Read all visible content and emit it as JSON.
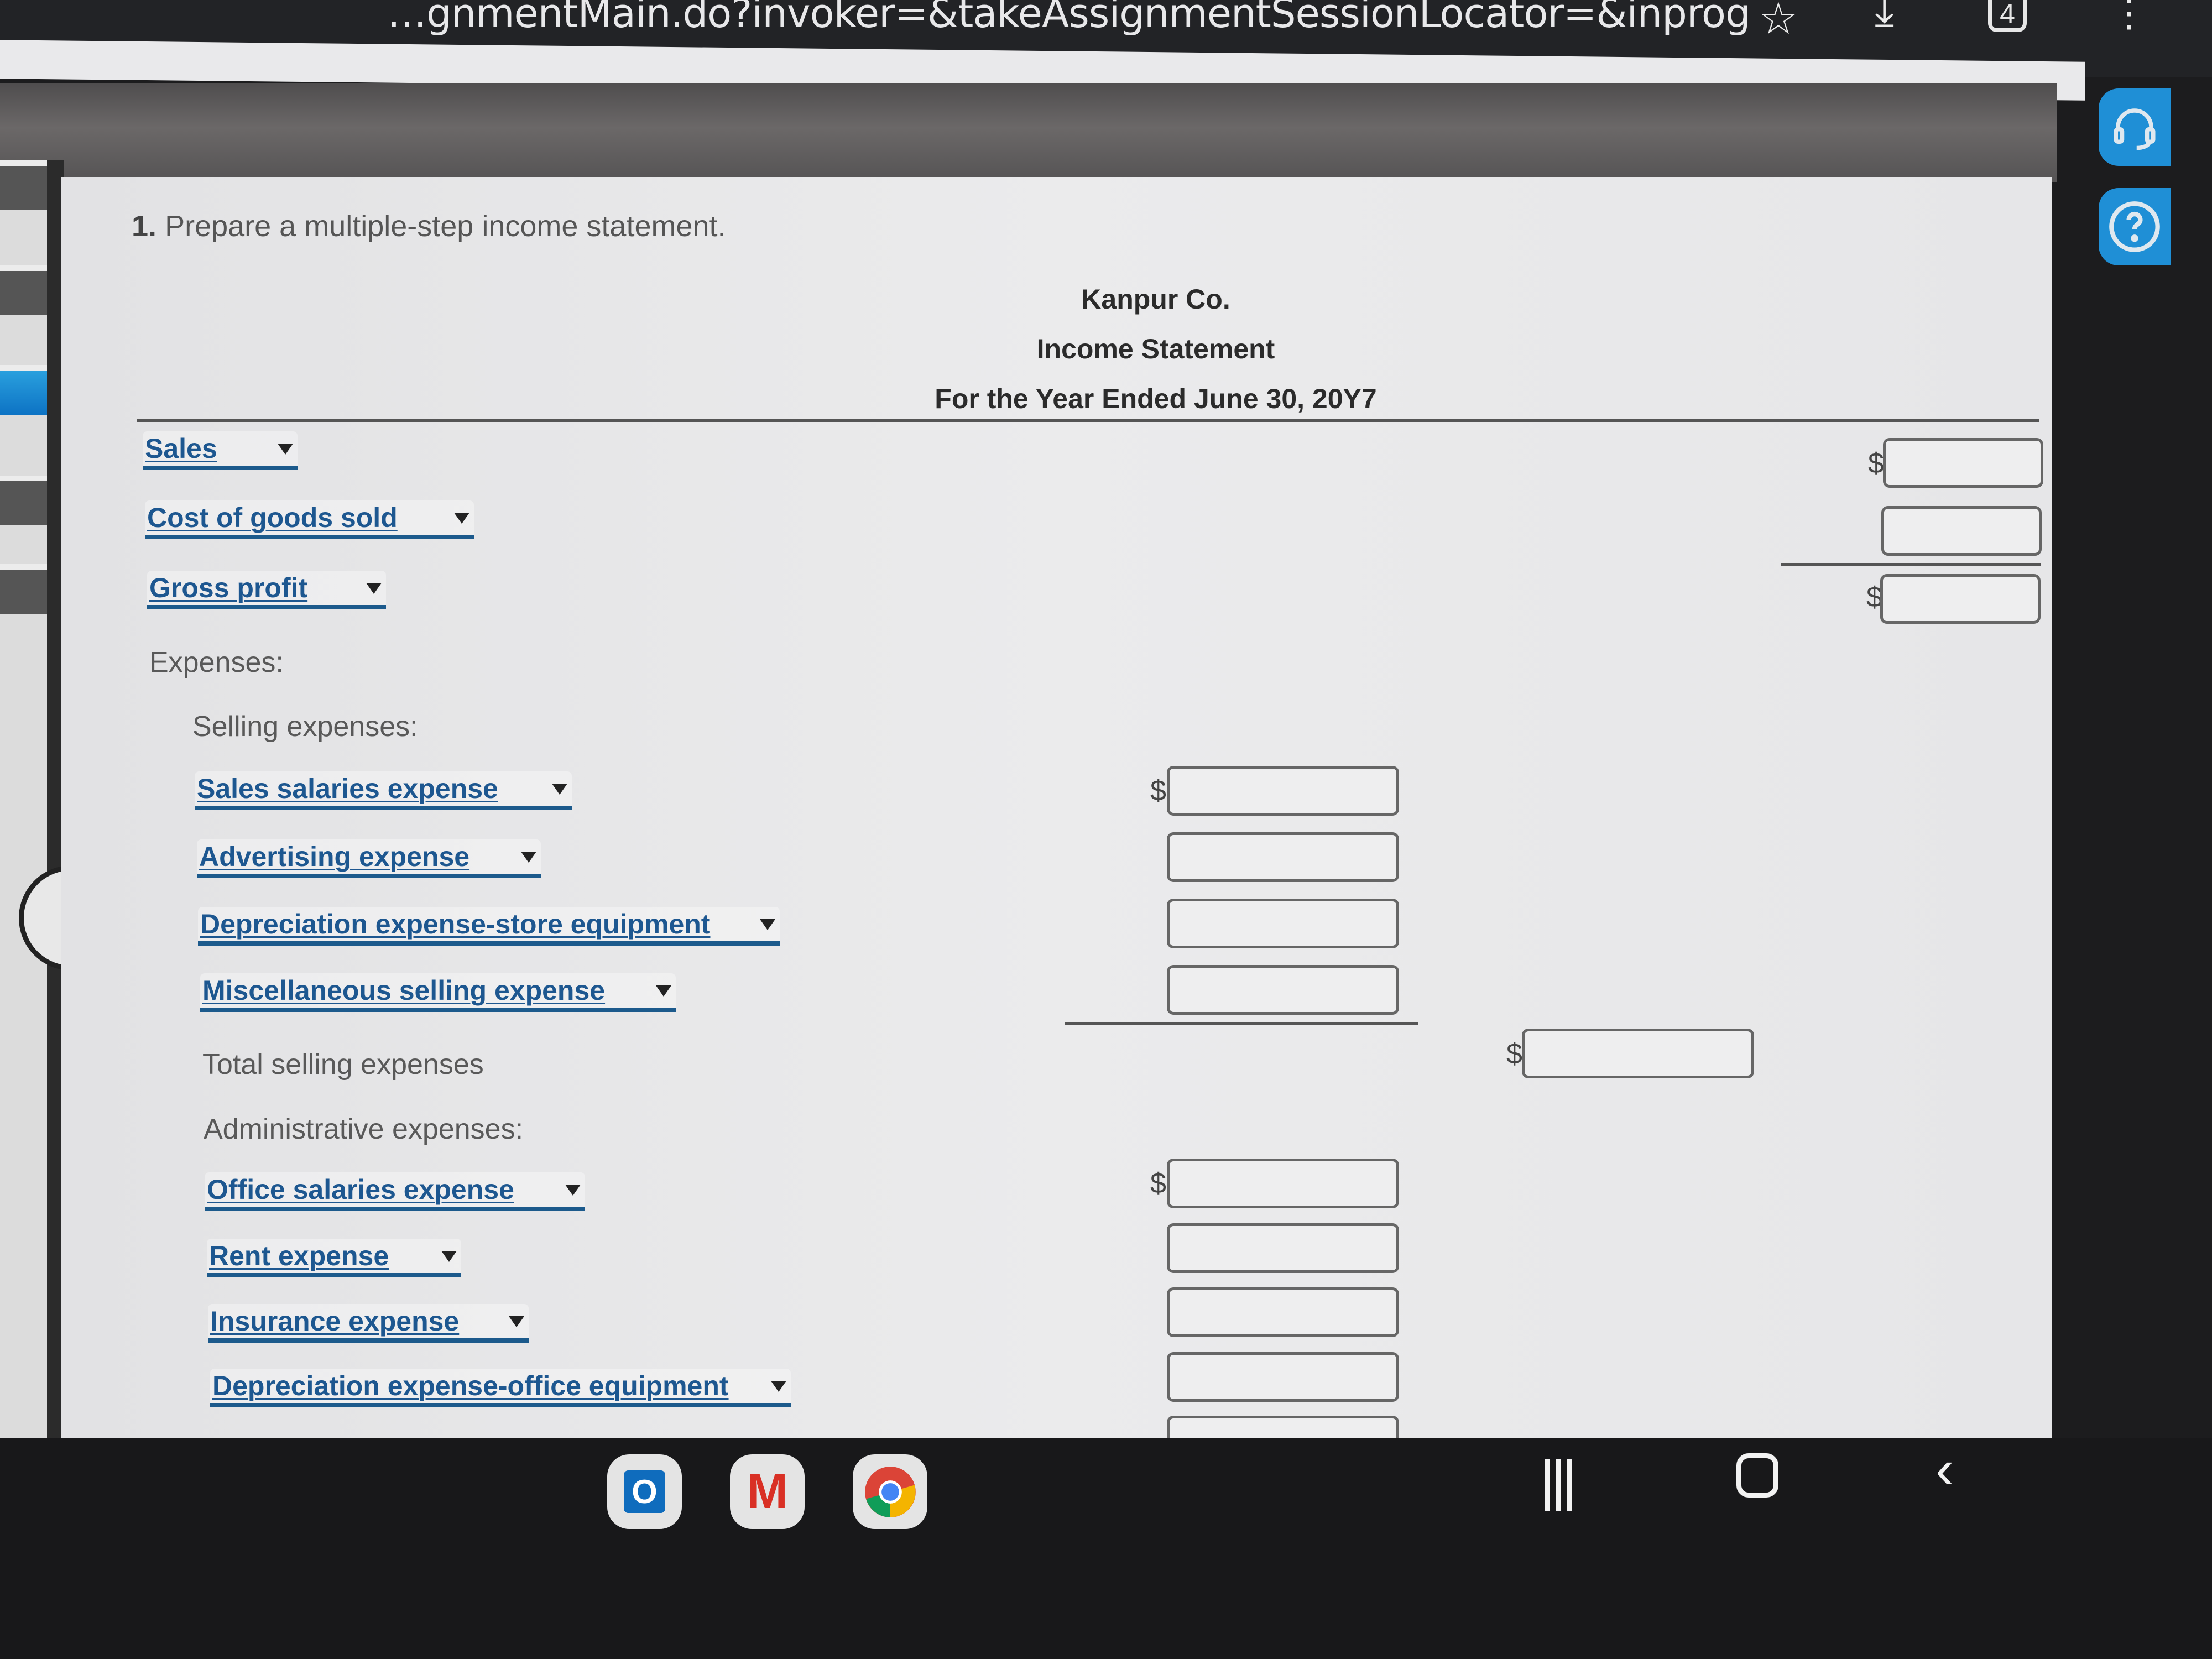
{
  "browser": {
    "url_visible": "…gnmentMain.do?invoker=&takeAssignmentSessionLocator=&inprog",
    "tab_count": "4",
    "icons": [
      "bookmark-star-icon",
      "download-icon",
      "tab-count-icon",
      "more-menu-icon"
    ]
  },
  "side_buttons": {
    "support_icon": "headset-icon",
    "help_icon": "help-circle-icon",
    "prev_icon": "chevron-left-icon"
  },
  "question": {
    "number": "1.",
    "text": "Prepare a multiple-step income statement."
  },
  "statement": {
    "company": "Kanpur Co.",
    "title": "Income Statement",
    "period": "For the Year Ended June 30, 20Y7"
  },
  "rows": {
    "sales": {
      "selected": "Sales",
      "value": ""
    },
    "cogs": {
      "selected": "Cost of goods sold",
      "value": ""
    },
    "gross_profit": {
      "selected": "Gross profit",
      "value": ""
    },
    "expenses_label": "Expenses:",
    "selling_label": "Selling expenses:",
    "selling_items": [
      {
        "selected": "Sales salaries expense",
        "value": ""
      },
      {
        "selected": "Advertising expense",
        "value": ""
      },
      {
        "selected": "Depreciation expense-store equipment",
        "value": ""
      },
      {
        "selected": "Miscellaneous selling expense",
        "value": ""
      }
    ],
    "total_selling_label": "Total selling expenses",
    "total_selling_value": "",
    "admin_label": "Administrative expenses:",
    "admin_items": [
      {
        "selected": "Office salaries expense",
        "value": ""
      },
      {
        "selected": "Rent expense",
        "value": ""
      },
      {
        "selected": "Insurance expense",
        "value": ""
      },
      {
        "selected": "Depreciation expense-office equipment",
        "value": ""
      }
    ],
    "currency_symbol": "$"
  },
  "taskbar": {
    "apps": [
      "Outlook",
      "Gmail",
      "Chrome"
    ],
    "nav": [
      "recent-apps",
      "home",
      "back"
    ]
  },
  "colors": {
    "dropdown_text": "#1d5790",
    "accent_blue": "#1f8fd6"
  }
}
